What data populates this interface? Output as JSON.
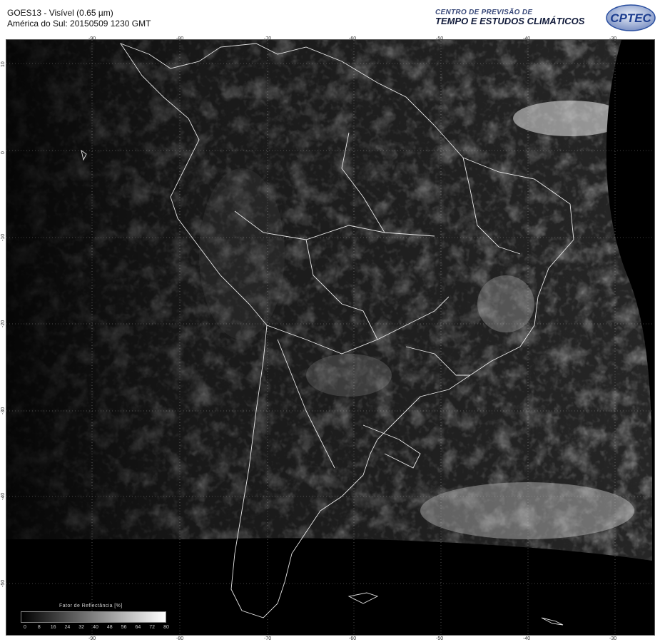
{
  "header": {
    "title_line1": "GOES13 - Visível (0.65 µm)",
    "title_line2": "América do Sul: 20150509 1230 GMT",
    "org_line1": "CENTRO DE PREVISÃO DE",
    "org_line2": "TEMPO E ESTUDOS CLIMÁTICOS",
    "logo_text": "CPTEC"
  },
  "axes": {
    "longitude_ticks": [
      "-90",
      "-80",
      "-70",
      "-60",
      "-50",
      "-40",
      "-30"
    ],
    "latitude_ticks": [
      "10",
      "0",
      "-10",
      "-20",
      "-30",
      "-40",
      "-50"
    ]
  },
  "legend": {
    "title": "Fator de Reflectância [%]",
    "ticks": [
      "0",
      "8",
      "16",
      "24",
      "32",
      "40",
      "48",
      "56",
      "64",
      "72",
      "80"
    ]
  },
  "colors": {
    "background": "#ffffff",
    "map_background": "#000000",
    "org_accent": "#3a4a7a",
    "logo_blue": "#2a4fa0"
  },
  "icons": {
    "logo": "cptec-logo"
  }
}
